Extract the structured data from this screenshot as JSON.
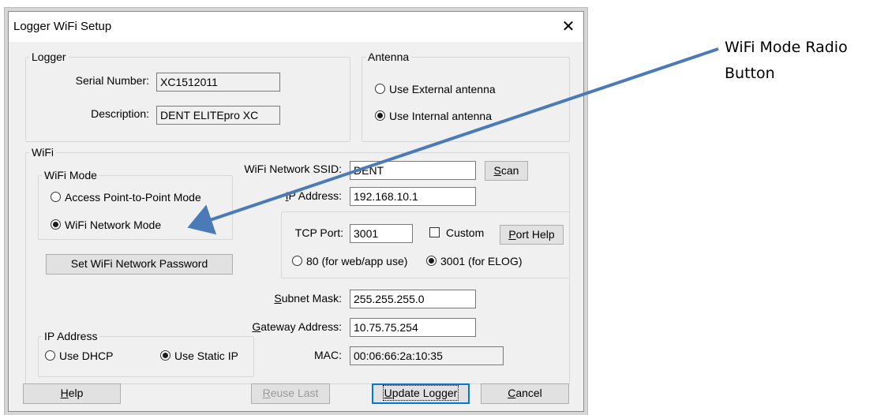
{
  "dialog": {
    "title": "Logger WiFi Setup",
    "close_glyph": "✕"
  },
  "logger": {
    "group_label": "Logger",
    "serial_label": "Serial Number:",
    "serial_value": "XC1512011",
    "description_label": "Description:",
    "description_value": "DENT ELITEpro XC"
  },
  "antenna": {
    "group_label": "Antenna",
    "options": [
      {
        "label": "Use External antenna",
        "selected": false
      },
      {
        "label": "Use Internal antenna",
        "selected": true
      }
    ]
  },
  "wifi": {
    "group_label": "WiFi",
    "mode_group_label": "WiFi Mode",
    "mode_options": [
      {
        "label": "Access Point-to-Point Mode",
        "selected": false
      },
      {
        "label": "WiFi Network Mode",
        "selected": true
      }
    ],
    "set_password_button": "Set WiFi Network Password",
    "ssid_label": "WiFi Network SSID:",
    "ssid_value": "DENT",
    "scan_button": {
      "prefix": "",
      "accel": "S",
      "rest": "can"
    },
    "ip_label": {
      "prefix": "",
      "accel": "I",
      "rest": "P Address:"
    },
    "ip_value": "192.168.10.1",
    "tcp_port_label": "TCP Port:",
    "tcp_port_value": "3001",
    "custom_label": "Custom",
    "custom_checked": false,
    "port_help_button": {
      "prefix": "",
      "accel": "P",
      "rest": "ort Help"
    },
    "port_options": [
      {
        "label": "80 (for web/app use)",
        "selected": false
      },
      {
        "label": "3001 (for ELOG)",
        "selected": true
      }
    ],
    "subnet_label": {
      "prefix": "",
      "accel": "S",
      "rest": "ubnet Mask:"
    },
    "subnet_value": "255.255.255.0",
    "gateway_label": {
      "prefix": "",
      "accel": "G",
      "rest": "ateway Address:"
    },
    "gateway_value": "10.75.75.254",
    "mac_label": "MAC:",
    "mac_value": "00:06:66:2a:10:35",
    "ip_address_group_label": "IP Address",
    "ip_address_options": [
      {
        "label": "Use DHCP",
        "selected": false
      },
      {
        "label": "Use Static IP",
        "selected": true
      }
    ]
  },
  "footer": {
    "help_button": {
      "prefix": "",
      "accel": "H",
      "rest": "elp"
    },
    "reuse_button": {
      "prefix": "",
      "accel": "R",
      "rest": "euse Last"
    },
    "update_button": {
      "prefix": "",
      "accel": "U",
      "rest": "pdate Logger"
    },
    "cancel_button": {
      "prefix": "",
      "accel": "C",
      "rest": "ancel"
    }
  },
  "annotation": {
    "text": "WiFi Mode Radio Button",
    "arrow_color": "#4a7ab8"
  },
  "colors": {
    "dialog_bg": "#f0f0f0",
    "default_button_border": "#0078d7"
  }
}
